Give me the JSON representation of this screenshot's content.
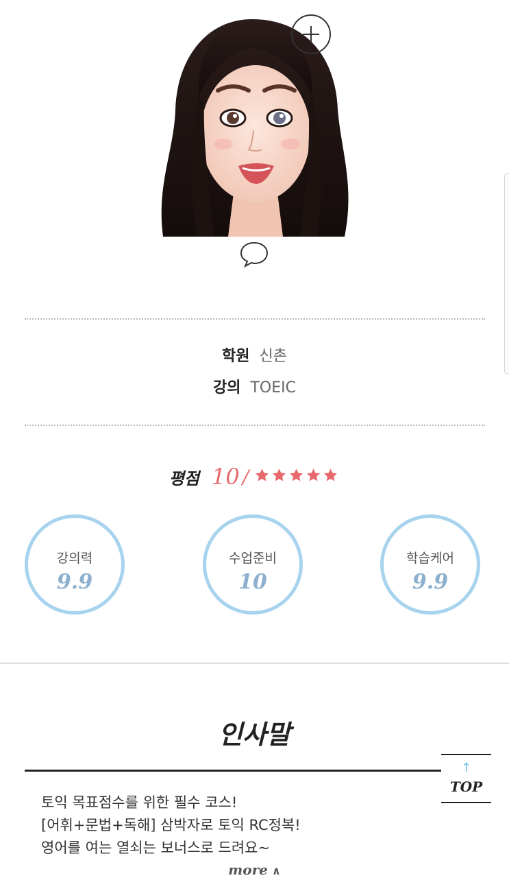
{
  "profile": {
    "add_icon": "plus-circle-icon",
    "comment_icon": "speech-bubble-icon"
  },
  "info": {
    "academy_label": "학원",
    "academy_value": "신촌",
    "course_label": "강의",
    "course_value": "TOEIC"
  },
  "rating": {
    "label": "평점",
    "score": "10",
    "separator": "/",
    "stars": 5,
    "star_color": "#e8696d"
  },
  "metrics": [
    {
      "label": "강의력",
      "value": "9.9"
    },
    {
      "label": "수업준비",
      "value": "10"
    },
    {
      "label": "학습케어",
      "value": "9.9"
    }
  ],
  "greeting": {
    "title": "인사말",
    "lines": [
      "토익 목표점수를 위한 필수 코스!",
      "[어휘+문법+독해] 삼박자로 토익 RC정복!",
      "영어를 여는 열쇠는 보너스로 드려요~"
    ],
    "more_label": "more"
  },
  "top_button": {
    "label": "TOP",
    "arrow": "↑"
  },
  "colors": {
    "accent_pink": "#e8696d",
    "circle_blue": "#a8d3ee",
    "value_blue": "#8db0cf",
    "top_arrow": "#6fc2e6"
  }
}
